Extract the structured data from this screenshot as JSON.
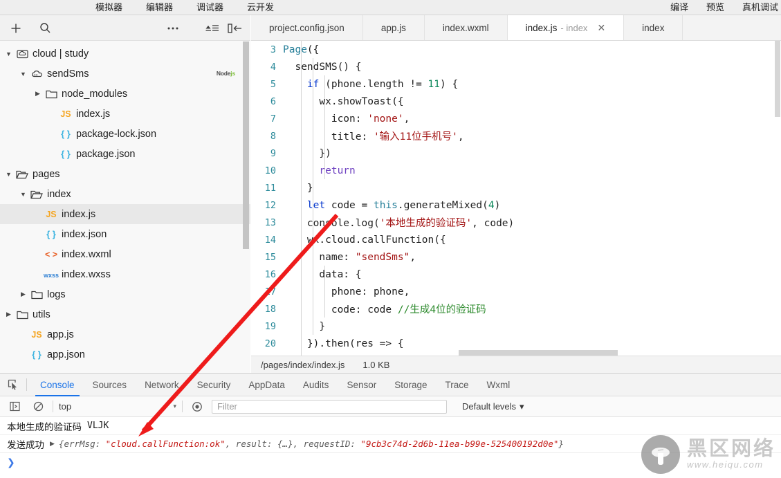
{
  "topbar": {
    "center_items": [
      {
        "label": "模拟器",
        "name": "simulator"
      },
      {
        "label": "编辑器",
        "name": "editor"
      },
      {
        "label": "调试器",
        "name": "debugger"
      },
      {
        "label": "云开发",
        "name": "cloud-dev"
      }
    ],
    "right_items": [
      {
        "label": "编译",
        "name": "compile"
      },
      {
        "label": "预览",
        "name": "preview"
      },
      {
        "label": "真机调试",
        "name": "remote-debug"
      }
    ]
  },
  "sidebar": {
    "toolbar": {
      "add": "+",
      "search_icon": "search-icon",
      "more_icon": "more-icon",
      "sort_icon": "collapse-all-icon",
      "panel_icon": "toggle-panel-icon"
    },
    "tree": [
      {
        "label": "cloud | study",
        "indent": 0,
        "twisty": "down",
        "icon": "cloud-folder",
        "badge": ""
      },
      {
        "label": "sendSms",
        "indent": 1,
        "twisty": "down",
        "icon": "cloud-func",
        "badge": "Node.js"
      },
      {
        "label": "node_modules",
        "indent": 2,
        "twisty": "right",
        "icon": "folder",
        "badge": ""
      },
      {
        "label": "index.js",
        "indent": 3,
        "twisty": "none",
        "icon": "js",
        "badge": ""
      },
      {
        "label": "package-lock.json",
        "indent": 3,
        "twisty": "none",
        "icon": "json",
        "badge": ""
      },
      {
        "label": "package.json",
        "indent": 3,
        "twisty": "none",
        "icon": "json",
        "badge": ""
      },
      {
        "label": "pages",
        "indent": 0,
        "twisty": "down",
        "icon": "folder-open",
        "badge": ""
      },
      {
        "label": "index",
        "indent": 1,
        "twisty": "down",
        "icon": "folder-open",
        "badge": ""
      },
      {
        "label": "index.js",
        "indent": 2,
        "twisty": "none",
        "icon": "js",
        "badge": "",
        "selected": true
      },
      {
        "label": "index.json",
        "indent": 2,
        "twisty": "none",
        "icon": "json",
        "badge": ""
      },
      {
        "label": "index.wxml",
        "indent": 2,
        "twisty": "none",
        "icon": "wxml",
        "badge": ""
      },
      {
        "label": "index.wxss",
        "indent": 2,
        "twisty": "none",
        "icon": "wxss",
        "badge": ""
      },
      {
        "label": "logs",
        "indent": 1,
        "twisty": "right",
        "icon": "folder",
        "badge": ""
      },
      {
        "label": "utils",
        "indent": 0,
        "twisty": "right",
        "icon": "folder",
        "badge": ""
      },
      {
        "label": "app.js",
        "indent": 1,
        "twisty": "none",
        "icon": "js",
        "badge": ""
      },
      {
        "label": "app.json",
        "indent": 1,
        "twisty": "none",
        "icon": "json",
        "badge": ""
      }
    ]
  },
  "editor": {
    "tabs": [
      {
        "label": "project.config.json",
        "suffix": "",
        "active": false,
        "closable": false
      },
      {
        "label": "app.js",
        "suffix": "",
        "active": false,
        "closable": false
      },
      {
        "label": "index.wxml",
        "suffix": "",
        "active": false,
        "closable": false
      },
      {
        "label": "index.js",
        "suffix": "- index",
        "active": true,
        "closable": true,
        "close_glyph": "✕"
      },
      {
        "label": "index",
        "suffix": "",
        "active": false,
        "closable": false
      }
    ],
    "first_line_number": 3,
    "lines": [
      {
        "n": "3",
        "text": "Page({"
      },
      {
        "n": "4",
        "text": "  sendSMS() {"
      },
      {
        "n": "5",
        "text": "    if (phone.length != 11) {"
      },
      {
        "n": "6",
        "text": "      wx.showToast({"
      },
      {
        "n": "7",
        "text": "        icon: 'none',"
      },
      {
        "n": "8",
        "text": "        title: '输入11位手机号',"
      },
      {
        "n": "9",
        "text": "      })"
      },
      {
        "n": "10",
        "text": "      return"
      },
      {
        "n": "11",
        "text": "    }"
      },
      {
        "n": "12",
        "text": "    let code = this.generateMixed(4)"
      },
      {
        "n": "13",
        "text": "    console.log('本地生成的验证码', code)"
      },
      {
        "n": "14",
        "text": "    wx.cloud.callFunction({"
      },
      {
        "n": "15",
        "text": "      name: \"sendSms\","
      },
      {
        "n": "16",
        "text": "      data: {"
      },
      {
        "n": "17",
        "text": "        phone: phone,"
      },
      {
        "n": "18",
        "text": "        code: code //生成4位的验证码"
      },
      {
        "n": "19",
        "text": "      }"
      },
      {
        "n": "20",
        "text": "    }).then(res => {"
      }
    ],
    "status": {
      "path": "/pages/index/index.js",
      "size": "1.0 KB"
    }
  },
  "devtools": {
    "inspect_icon": "inspect-element-icon",
    "tabs": [
      {
        "label": "Console",
        "active": true
      },
      {
        "label": "Sources",
        "active": false
      },
      {
        "label": "Network",
        "active": false
      },
      {
        "label": "Security",
        "active": false
      },
      {
        "label": "AppData",
        "active": false
      },
      {
        "label": "Audits",
        "active": false
      },
      {
        "label": "Sensor",
        "active": false
      },
      {
        "label": "Storage",
        "active": false
      },
      {
        "label": "Trace",
        "active": false
      },
      {
        "label": "Wxml",
        "active": false
      }
    ],
    "filterbar": {
      "sidebar_toggle_icon": "console-sidebar-icon",
      "clear_icon": "clear-console-icon",
      "context": "top",
      "context_caret": "▾",
      "eye_icon": "live-expression-icon",
      "filter_placeholder": "Filter",
      "filter_value": "",
      "levels_label": "Default levels",
      "levels_caret": "▾"
    },
    "console_lines": [
      {
        "kind": "log",
        "message": "本地生成的验证码",
        "value": "VLJK"
      },
      {
        "kind": "object",
        "message": "发送成功",
        "arrow": "▶",
        "object_prefix": "{errMsg: ",
        "object_errmsg": "\"cloud.callFunction:ok\"",
        "object_mid": ", result: {…}, requestID: ",
        "object_requestid": "\"9cb3c74d-2d6b-11ea-b99e-525400192d0e\"",
        "object_suffix": "}"
      }
    ],
    "prompt": "❯"
  },
  "watermark": {
    "cn": "黑区网络",
    "en": "www.heiqu.com",
    "logo_icon": "mushroom-logo-icon"
  },
  "colors": {
    "accent": "#1a73e8",
    "string": "#a31515",
    "keyword": "#0033cc",
    "comment": "#2c8a2c",
    "number": "#098658",
    "annotation_arrow": "#ee1b1b"
  }
}
